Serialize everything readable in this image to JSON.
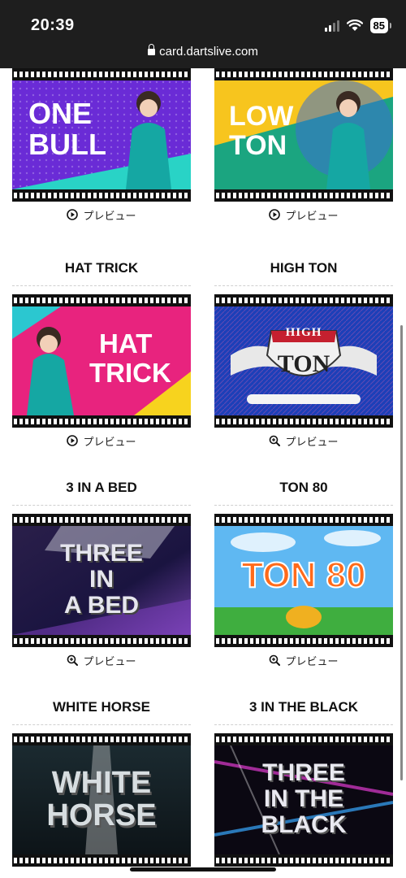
{
  "status_bar": {
    "time": "20:39",
    "battery": "85"
  },
  "browser": {
    "url": "card.dartslive.com"
  },
  "cards": [
    {
      "title": "",
      "thumb_lines": [
        "ONE",
        "BULL"
      ],
      "preview_label": "プレビュー",
      "preview_icon": "play-circle-icon"
    },
    {
      "title": "",
      "thumb_lines": [
        "LOW",
        "TON"
      ],
      "preview_label": "プレビュー",
      "preview_icon": "play-circle-icon"
    },
    {
      "title": "HAT TRICK",
      "thumb_lines": [
        "HAT",
        "TRICK"
      ],
      "preview_label": "プレビュー",
      "preview_icon": "play-circle-icon"
    },
    {
      "title": "HIGH TON",
      "thumb_lines": [
        "HIGH",
        "TON"
      ],
      "preview_label": "プレビュー",
      "preview_icon": "zoom-icon"
    },
    {
      "title": "3 IN A BED",
      "thumb_lines": [
        "THREE",
        "IN",
        "A BED"
      ],
      "preview_label": "プレビュー",
      "preview_icon": "zoom-icon"
    },
    {
      "title": "TON 80",
      "thumb_lines": [
        "TON 80"
      ],
      "preview_label": "プレビュー",
      "preview_icon": "zoom-icon"
    },
    {
      "title": "WHITE HORSE",
      "thumb_lines": [
        "WHITE",
        "HORSE"
      ],
      "preview_label": "",
      "preview_icon": ""
    },
    {
      "title": "3 IN THE BLACK",
      "thumb_lines": [
        "THREE",
        "IN THE",
        "BLACK"
      ],
      "preview_label": "",
      "preview_icon": ""
    }
  ],
  "colors": {
    "topbar": "#1e1e1e",
    "film": "#111111"
  }
}
